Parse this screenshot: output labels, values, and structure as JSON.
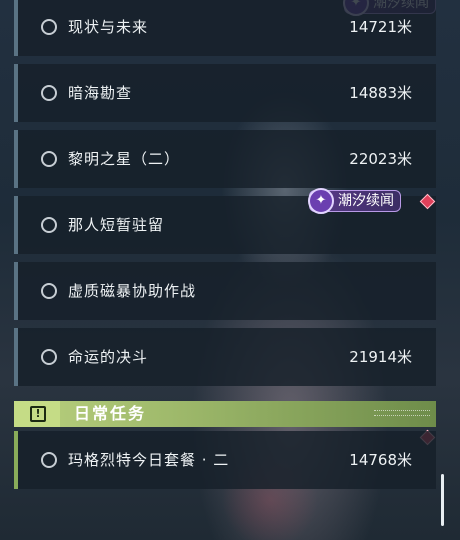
{
  "quests": [
    {
      "name": "现状与未来",
      "distance": "14721米"
    },
    {
      "name": "暗海勘查",
      "distance": "14883米"
    },
    {
      "name": "黎明之星（二）",
      "distance": "22023米"
    },
    {
      "name": "那人短暂驻留",
      "distance": ""
    },
    {
      "name": "虚质磁暴协助作战",
      "distance": ""
    },
    {
      "name": "命运的决斗",
      "distance": "21914米"
    }
  ],
  "event_tag": {
    "label": "潮汐续闻",
    "icon": "sparkle-star-icon"
  },
  "daily_section": {
    "title": "日常任务",
    "icon": "exclamation-box-icon",
    "accent": "#b9d07e"
  },
  "daily_quests": [
    {
      "name": "玛格烈特今日套餐 · 二",
      "distance": "14768米"
    }
  ],
  "colors": {
    "marker": "#e0405a",
    "tag_purple": "#5a3a8a",
    "quest_bar": "#5a7384",
    "daily_bar": "#8aac5a"
  }
}
